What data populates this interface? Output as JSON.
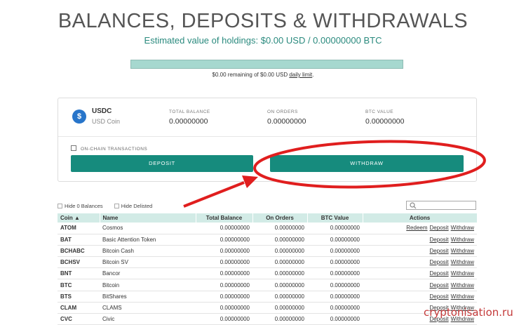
{
  "page": {
    "title": "BALANCES, DEPOSITS & WITHDRAWALS",
    "estimated": "Estimated value of holdings: $0.00 USD / 0.00000000 BTC",
    "limit_prefix": "$0.00 remaining of $0.00 USD ",
    "limit_link": "daily limit",
    "limit_suffix": ".",
    "limit_fraction": 1.0
  },
  "coin_card": {
    "symbol": "USDC",
    "name": "USD Coin",
    "icon_glyph": "$",
    "total_label": "TOTAL BALANCE",
    "total_value": "0.00000000",
    "orders_label": "ON ORDERS",
    "orders_value": "0.00000000",
    "btc_label": "BTC VALUE",
    "btc_value": "0.00000000",
    "onchain_label": "ON-CHAIN TRANSACTIONS",
    "deposit_label": "DEPOSIT",
    "withdraw_label": "WITHDRAW"
  },
  "filters": {
    "hide_zero": "Hide 0 Balances",
    "hide_delisted": "Hide Delisted"
  },
  "table": {
    "headers": [
      "Coin ▲",
      "Name",
      "Total Balance",
      "On Orders",
      "BTC Value",
      "Actions"
    ],
    "rows": [
      {
        "coin": "ATOM",
        "name": "Cosmos",
        "total": "0.00000000",
        "orders": "0.00000000",
        "btc": "0.00000000",
        "actions": [
          "Redeem",
          "Deposit",
          "Withdraw"
        ]
      },
      {
        "coin": "BAT",
        "name": "Basic Attention Token",
        "total": "0.00000000",
        "orders": "0.00000000",
        "btc": "0.00000000",
        "actions": [
          "Deposit",
          "Withdraw"
        ]
      },
      {
        "coin": "BCHABC",
        "name": "Bitcoin Cash",
        "total": "0.00000000",
        "orders": "0.00000000",
        "btc": "0.00000000",
        "actions": [
          "Deposit",
          "Withdraw"
        ]
      },
      {
        "coin": "BCHSV",
        "name": "Bitcoin SV",
        "total": "0.00000000",
        "orders": "0.00000000",
        "btc": "0.00000000",
        "actions": [
          "Deposit",
          "Withdraw"
        ]
      },
      {
        "coin": "BNT",
        "name": "Bancor",
        "total": "0.00000000",
        "orders": "0.00000000",
        "btc": "0.00000000",
        "actions": [
          "Deposit",
          "Withdraw"
        ]
      },
      {
        "coin": "BTC",
        "name": "Bitcoin",
        "total": "0.00000000",
        "orders": "0.00000000",
        "btc": "0.00000000",
        "actions": [
          "Deposit",
          "Withdraw"
        ]
      },
      {
        "coin": "BTS",
        "name": "BitShares",
        "total": "0.00000000",
        "orders": "0.00000000",
        "btc": "0.00000000",
        "actions": [
          "Deposit",
          "Withdraw"
        ]
      },
      {
        "coin": "CLAM",
        "name": "CLAMS",
        "total": "0.00000000",
        "orders": "0.00000000",
        "btc": "0.00000000",
        "actions": [
          "Deposit",
          "Withdraw"
        ]
      },
      {
        "coin": "CVC",
        "name": "Civic",
        "total": "0.00000000",
        "orders": "0.00000000",
        "btc": "0.00000000",
        "actions": [
          "Deposit",
          "Withdraw"
        ]
      }
    ]
  },
  "watermark": "cryptonisation.ru",
  "colors": {
    "accent": "#168b7d",
    "header_bg": "#d2ebe6",
    "annotation": "#e01e1e"
  }
}
